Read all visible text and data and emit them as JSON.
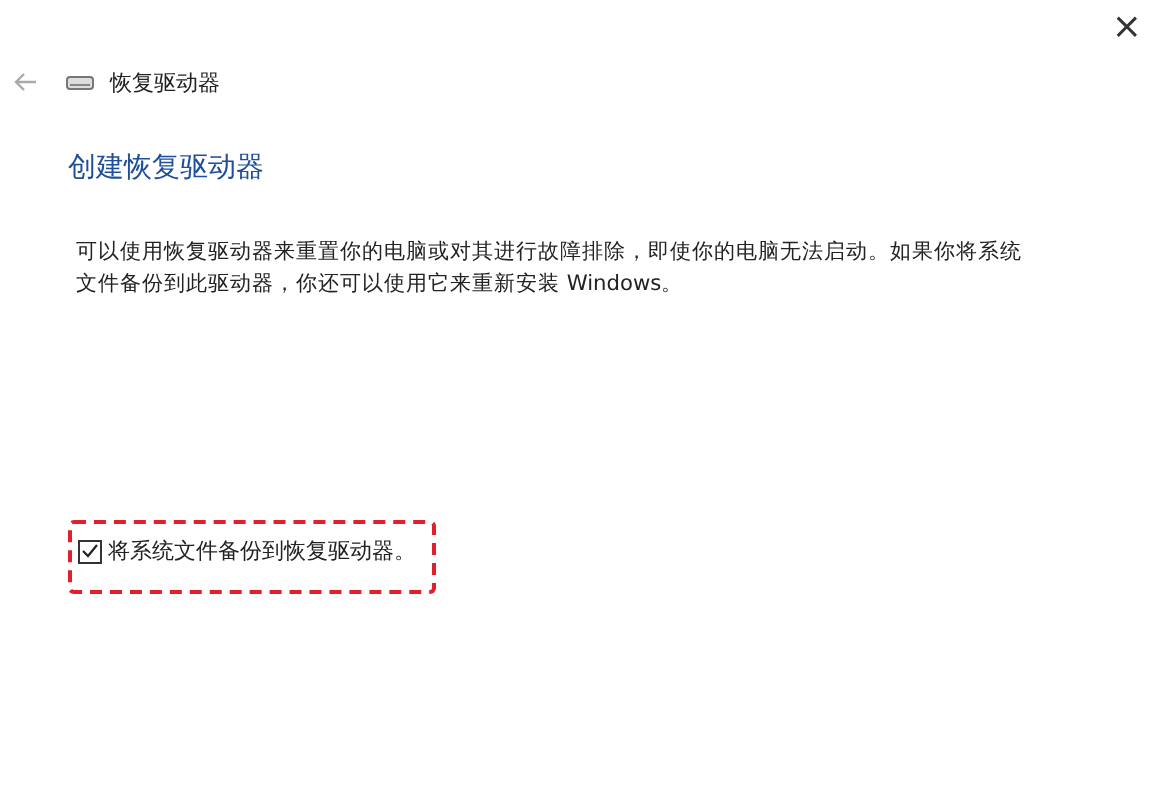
{
  "window": {
    "close": "×",
    "title": "恢复驱动器"
  },
  "heading": "创建恢复驱动器",
  "description": "可以使用恢复驱动器来重置你的电脑或对其进行故障排除，即使你的电脑无法启动。如果你将系统文件备份到此驱动器，你还可以使用它来重新安装 Windows。",
  "checkbox": {
    "label": "将系统文件备份到恢复驱动器。",
    "checked": true,
    "highlighted": true
  }
}
